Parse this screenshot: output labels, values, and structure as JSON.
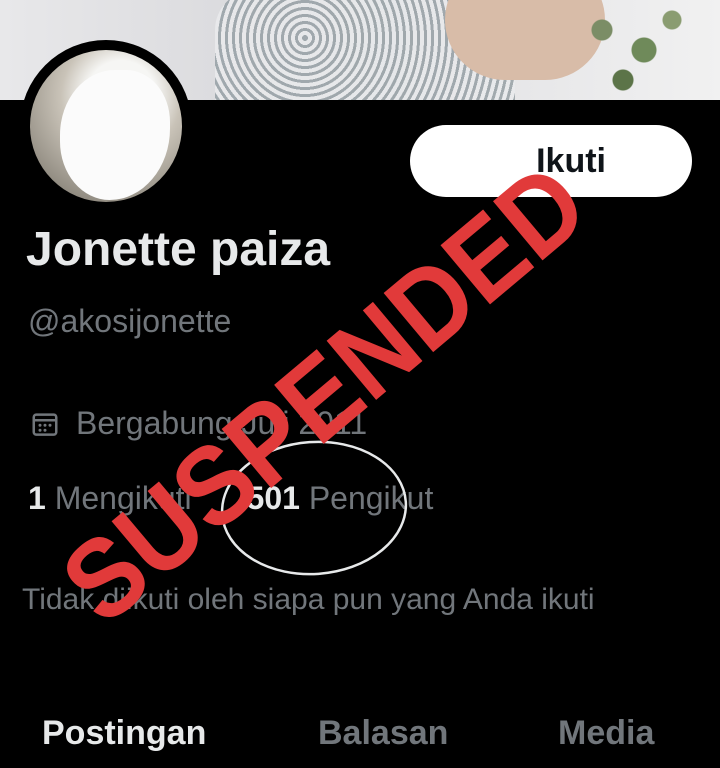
{
  "profile": {
    "display_name": "Jonette paiza",
    "handle": "@akosijonette",
    "follow_button": "Ikuti",
    "joined": "Bergabung Juli 2011",
    "following_count": "1",
    "following_label": "Mengikuti",
    "followers_count": "501",
    "followers_label": "Pengikut",
    "mutual_note": "Tidak diikuti oleh siapa pun yang Anda ikuti"
  },
  "tabs": [
    {
      "label": "Postingan",
      "active": true
    },
    {
      "label": "Balasan",
      "active": false
    },
    {
      "label": "Media",
      "active": false
    }
  ],
  "overlay": {
    "stamp_text": "SUSPENDED",
    "stamp_color": "#e13a3a"
  },
  "colors": {
    "background": "#000000",
    "text_primary": "#e7e9ea",
    "text_secondary": "#71767b",
    "button_bg": "#ffffff"
  },
  "icons": {
    "joined": "calendar-icon"
  }
}
